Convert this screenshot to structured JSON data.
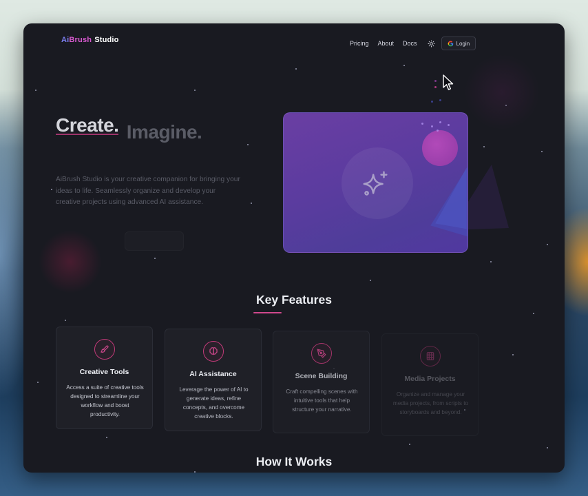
{
  "brand": {
    "part1": "Ai",
    "part2": "Brush",
    "part3": "Studio"
  },
  "nav": {
    "links": [
      "Pricing",
      "About",
      "Docs"
    ],
    "theme_icon": "sun-icon",
    "login_icon": "google-g-icon",
    "login_label": "Login"
  },
  "hero": {
    "title_word1": "Create.",
    "title_word2": "Imagine.",
    "description": "AiBrush Studio is your creative companion for bringing your ideas to life. Seamlessly organize and develop your creative projects using advanced AI assistance.",
    "card_icon": "sparkle-icon"
  },
  "features": {
    "heading": "Key Features",
    "items": [
      {
        "icon": "paintbrush-icon",
        "title": "Creative Tools",
        "description": "Access a suite of creative tools designed to streamline your workflow and boost productivity."
      },
      {
        "icon": "brain-icon",
        "title": "AI Assistance",
        "description": "Leverage the power of AI to generate ideas, refine concepts, and overcome creative blocks."
      },
      {
        "icon": "pen-tool-icon",
        "title": "Scene Building",
        "description": "Craft compelling scenes with intuitive tools that help structure your narrative."
      },
      {
        "icon": "film-icon",
        "title": "Media Projects",
        "description": "Organize and manage your media projects, from scripts to storyboards and beyond."
      }
    ]
  },
  "how_it_works": {
    "heading": "How It Works"
  },
  "colors": {
    "background": "#191a21",
    "accent_pink": "#d0488d",
    "accent_blue": "#7b7ff0",
    "card_purple": "#5b3c9f"
  }
}
